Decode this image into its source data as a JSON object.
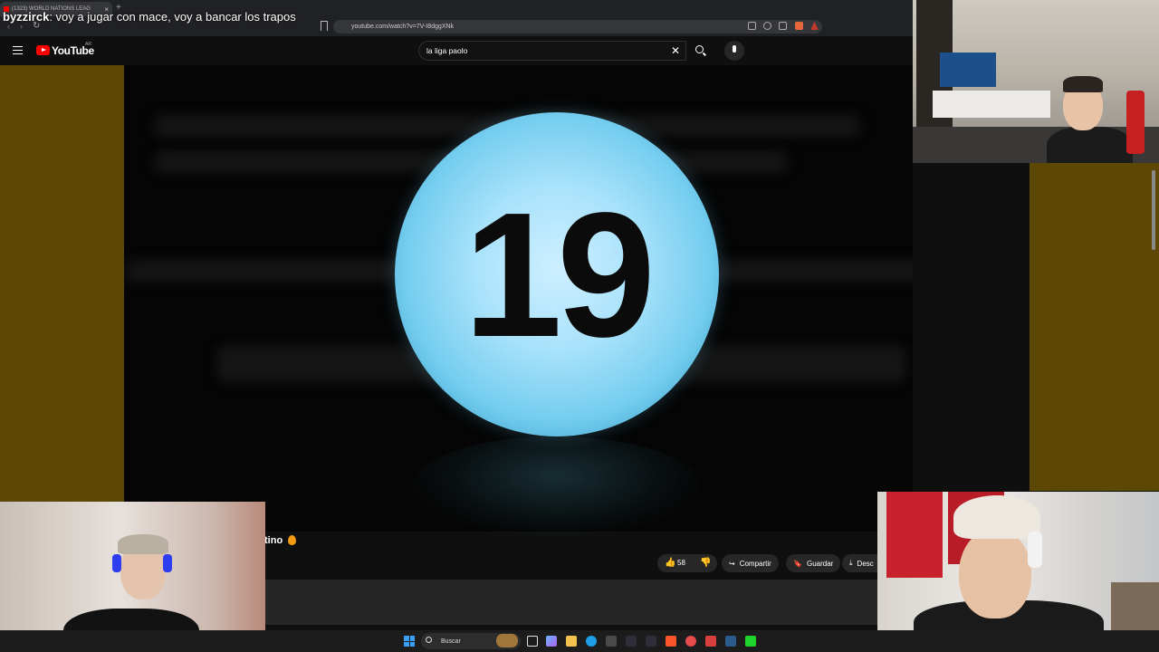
{
  "browser": {
    "tab_title": "(1323) WORLD NATIONS LEAG",
    "tab_close": "×",
    "new_tab": "+",
    "url": "youtube.com/watch?v=7V-I8dggXNk",
    "back": "‹",
    "forward": "›",
    "reload": "↻"
  },
  "chat": {
    "username": "byzzirck",
    "message": ": voy a jugar con mace, voy a bancar los trapos"
  },
  "youtube": {
    "logo_text": "YouTube",
    "region": "AR",
    "search_value": "la liga paolo",
    "search_clear": "✕"
  },
  "video": {
    "ball_number": "19",
    "title_fragment": "tino"
  },
  "actions": {
    "like_icon": "👍",
    "like_count": "58",
    "dislike_icon": "👎",
    "share_icon": "↪",
    "share": "Compartir",
    "save_icon": "🔖",
    "save": "Guardar",
    "download_icon": "⤓",
    "download": "Desc"
  },
  "taskbar": {
    "search": "Buscar"
  },
  "colors": {
    "ball": "#74cdef",
    "side_bars": "#5c4704",
    "youtube_red": "#ff0000"
  }
}
